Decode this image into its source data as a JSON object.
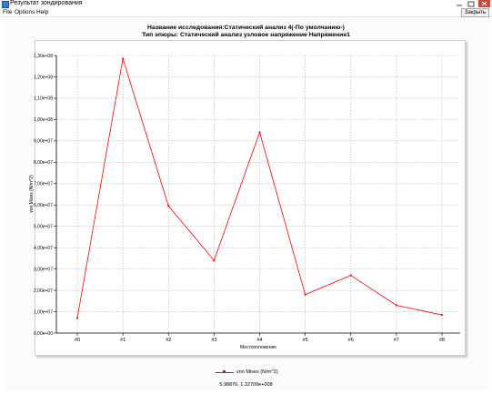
{
  "window": {
    "title": "Результат зондирования",
    "menu": [
      "File",
      "Options",
      "Help"
    ],
    "close_label": "Закрыть"
  },
  "colors": {
    "series": "#ff0000",
    "grid": "#b4b4b4"
  },
  "header": {
    "line1": "Название исследования:Статический анализ 4(-По умолчанию-)",
    "line2": "Тип эпюры: Статический анализ узловое напряжение Напряжение1"
  },
  "chart_data": {
    "type": "line",
    "categories": [
      "#0",
      "#1",
      "#2",
      "#3",
      "#4",
      "#5",
      "#6",
      "#7",
      "#8"
    ],
    "series": [
      {
        "name": "von Mises (N/m^2)",
        "values": [
          7000000,
          128500000,
          59500000,
          34000000,
          94000000,
          18000000,
          27000000,
          13000000,
          8500000
        ]
      }
    ],
    "ylim": [
      0,
      130000000
    ],
    "yticks": [
      "0,00e+00",
      "1,00e+07",
      "2,00e+07",
      "3,00e+07",
      "4,00e+07",
      "5,00e+07",
      "6,00e+07",
      "7,00e+07",
      "8,00e+07",
      "9,00e+07",
      "1,00e+08",
      "1,10e+08",
      "1,20e+08",
      "1,30e+08"
    ],
    "xlabel": "Местоположение",
    "ylabel": "von Mises (N/m^2)",
    "grid": true,
    "legend_position": "bottom"
  },
  "status": {
    "coords": "5.98876, 1.32709e+008"
  }
}
